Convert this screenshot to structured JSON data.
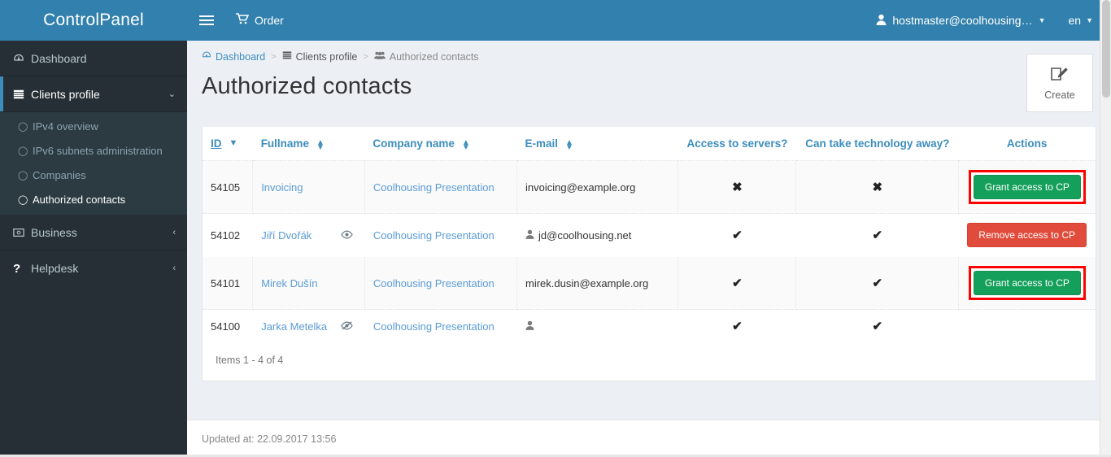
{
  "brand": {
    "title": "ControlPanel"
  },
  "topbar": {
    "menu_toggle_icon": "hamburger-icon",
    "order_label": "Order",
    "order_icon": "shopping-cart-icon",
    "user_label": "hostmaster@coolhousing…",
    "user_icon": "user-icon",
    "lang_label": "en",
    "caret_icon": "caret-down-icon"
  },
  "sidebar": {
    "items": [
      {
        "label": "Dashboard",
        "icon": "dashboard-icon",
        "active": false,
        "caret": ""
      },
      {
        "label": "Clients profile",
        "icon": "list-icon",
        "active": true,
        "caret": "⌄"
      },
      {
        "label": "Business",
        "icon": "money-icon",
        "active": false,
        "caret": "‹"
      },
      {
        "label": "Helpdesk",
        "icon": "question-icon",
        "active": false,
        "caret": "‹"
      }
    ],
    "submenu": [
      {
        "label": "IPv4 overview",
        "active": false
      },
      {
        "label": "IPv6 subnets administration",
        "active": false
      },
      {
        "label": "Companies",
        "active": false
      },
      {
        "label": "Authorized contacts",
        "active": true
      }
    ]
  },
  "breadcrumb": [
    {
      "label": "Dashboard",
      "icon": "dashboard-icon",
      "current": false
    },
    {
      "label": "Clients profile",
      "icon": "list-icon",
      "current": false
    },
    {
      "label": "Authorized contacts",
      "icon": "users-icon",
      "current": true
    }
  ],
  "page": {
    "title": "Authorized contacts"
  },
  "create": {
    "label": "Create",
    "icon": "edit-pencil-icon"
  },
  "table": {
    "columns": [
      {
        "label": "ID",
        "sort": "desc",
        "align": "left"
      },
      {
        "label": "Fullname",
        "sort": "both",
        "align": "left"
      },
      {
        "label": "Company name",
        "sort": "both",
        "align": "left"
      },
      {
        "label": "E-mail",
        "sort": "both",
        "align": "left"
      },
      {
        "label": "Access to servers?",
        "sort": "none",
        "align": "center"
      },
      {
        "label": "Can take technology away?",
        "sort": "none",
        "align": "center"
      },
      {
        "label": "Actions",
        "sort": "none",
        "align": "center"
      }
    ],
    "rows": [
      {
        "id": "54105",
        "fullname": "Invoicing",
        "name_icon": "",
        "company": "Coolhousing Presentation",
        "email": "invoicing@example.org",
        "email_icon": "",
        "access_servers": "✖",
        "take_away": "✖",
        "action_label": "Grant access to CP",
        "action_type": "grant",
        "highlighted": true
      },
      {
        "id": "54102",
        "fullname": "Jiří Dvořák",
        "name_icon": "eye-icon",
        "company": "Coolhousing Presentation",
        "email": "jd@coolhousing.net",
        "email_icon": "user-icon",
        "access_servers": "✔",
        "take_away": "✔",
        "action_label": "Remove access to CP",
        "action_type": "remove",
        "highlighted": false
      },
      {
        "id": "54101",
        "fullname": "Mirek Dušín",
        "name_icon": "",
        "company": "Coolhousing Presentation",
        "email": "mirek.dusin@example.org",
        "email_icon": "",
        "access_servers": "✔",
        "take_away": "✔",
        "action_label": "Grant access to CP",
        "action_type": "grant",
        "highlighted": true
      },
      {
        "id": "54100",
        "fullname": "Jarka Metelka",
        "name_icon": "eye-slash-icon",
        "company": "Coolhousing Presentation",
        "email": "",
        "email_icon": "user-icon",
        "access_servers": "✔",
        "take_away": "✔",
        "action_label": "",
        "action_type": "none",
        "highlighted": false
      }
    ],
    "items_summary": "Items 1 - 4 of 4"
  },
  "footer": {
    "updated": "Updated at: 22.09.2017 13:56"
  },
  "colors": {
    "brand_blue": "#3180ad",
    "sidebar_dark": "#262f36",
    "submenu_dark": "#2c3b41",
    "link_blue": "#3c8dbc",
    "grant_green": "#14a05a",
    "remove_red": "#e04b3b",
    "highlight_red": "#ff0000",
    "page_bg": "#ecf0f5"
  }
}
